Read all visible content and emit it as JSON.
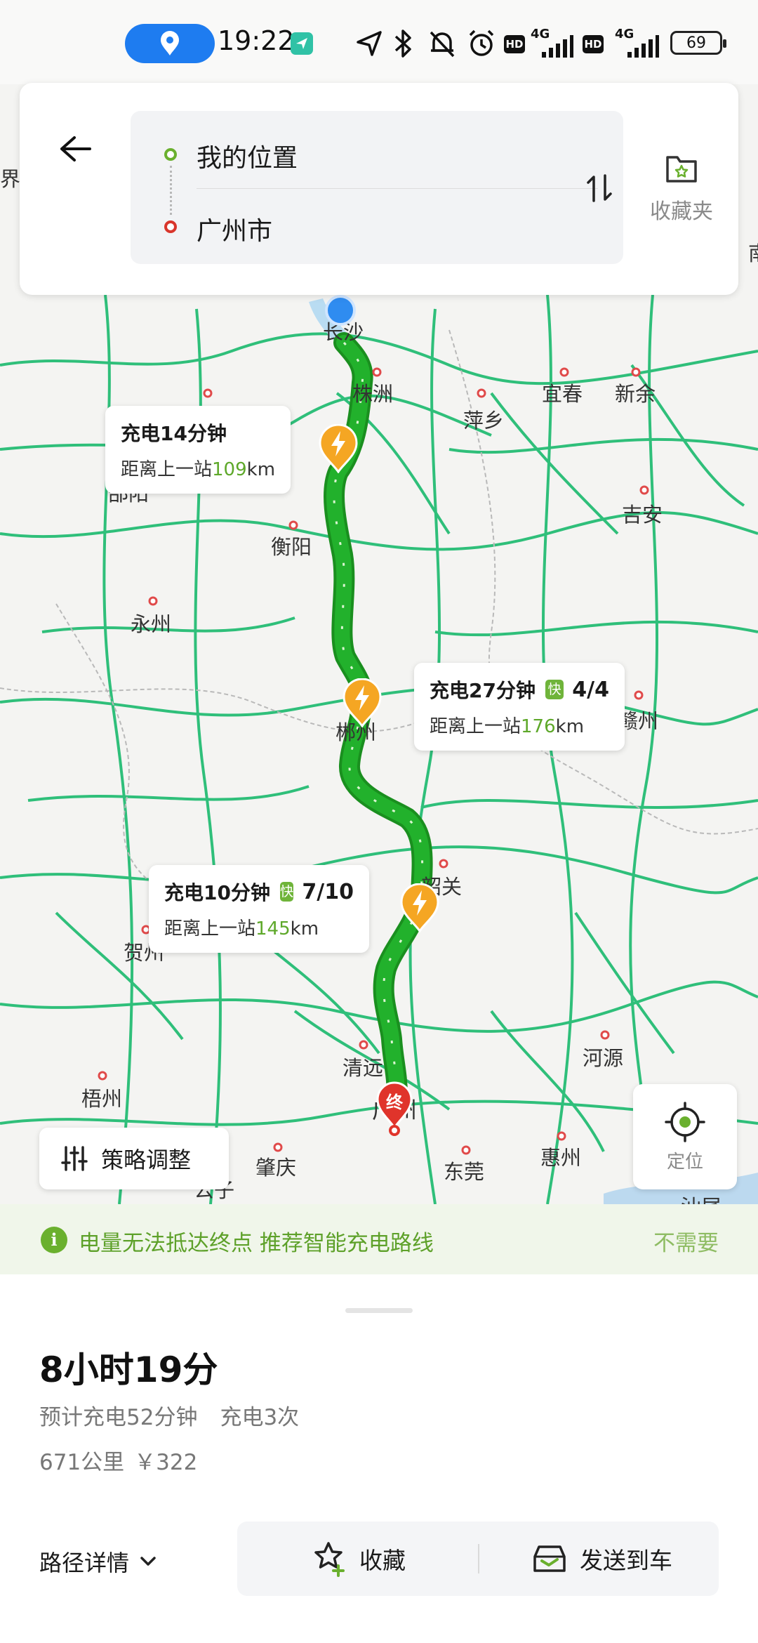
{
  "status_bar": {
    "time": "19:22",
    "battery": "69",
    "network_tags": [
      "HD",
      "4G",
      "HD",
      "4G"
    ],
    "icons": [
      "location-icon",
      "send-icon",
      "navigation-arrow-icon",
      "bluetooth-icon",
      "mute-icon",
      "alarm-icon",
      "signal-icon",
      "battery-icon"
    ]
  },
  "route_card": {
    "from": "我的位置",
    "to": "广州市",
    "favorites_label": "收藏夹"
  },
  "map": {
    "cities": [
      "界",
      "长沙",
      "株洲",
      "萍乡",
      "宜春",
      "新余",
      "邵阳",
      "衡阳",
      "吉安",
      "永州",
      "郴州",
      "赣州",
      "韶关",
      "贺州",
      "清远",
      "河源",
      "梧州",
      "广州",
      "肇庆",
      "东莞",
      "惠州",
      "汕尾",
      "公子",
      "南"
    ],
    "end_marker": "终",
    "route_color": "#22b12c",
    "road_color": "#2fbf7a"
  },
  "charge_stops": [
    {
      "duration": "充电14分钟",
      "distance_prefix": "距离上一站",
      "distance_value": "109",
      "distance_unit": "km",
      "fast": "",
      "availability": ""
    },
    {
      "duration": "充电27分钟",
      "distance_prefix": "距离上一站",
      "distance_value": "176",
      "distance_unit": "km",
      "fast": "快",
      "availability": "4/4"
    },
    {
      "duration": "充电10分钟",
      "distance_prefix": "距离上一站",
      "distance_value": "145",
      "distance_unit": "km",
      "fast": "快",
      "availability": "7/10"
    }
  ],
  "controls": {
    "strategy": "策略调整",
    "locate": "定位"
  },
  "warning": {
    "icon": "i",
    "text": "电量无法抵达终点 推荐智能充电路线",
    "dismiss": "不需要"
  },
  "summary": {
    "duration": "8小时19分",
    "charge_time": "预计充电52分钟",
    "charge_count": "充电3次",
    "distance": "671公里",
    "cost": "￥322"
  },
  "actions": {
    "route_detail": "路径详情",
    "favorite": "收藏",
    "send_to_car": "发送到车"
  }
}
